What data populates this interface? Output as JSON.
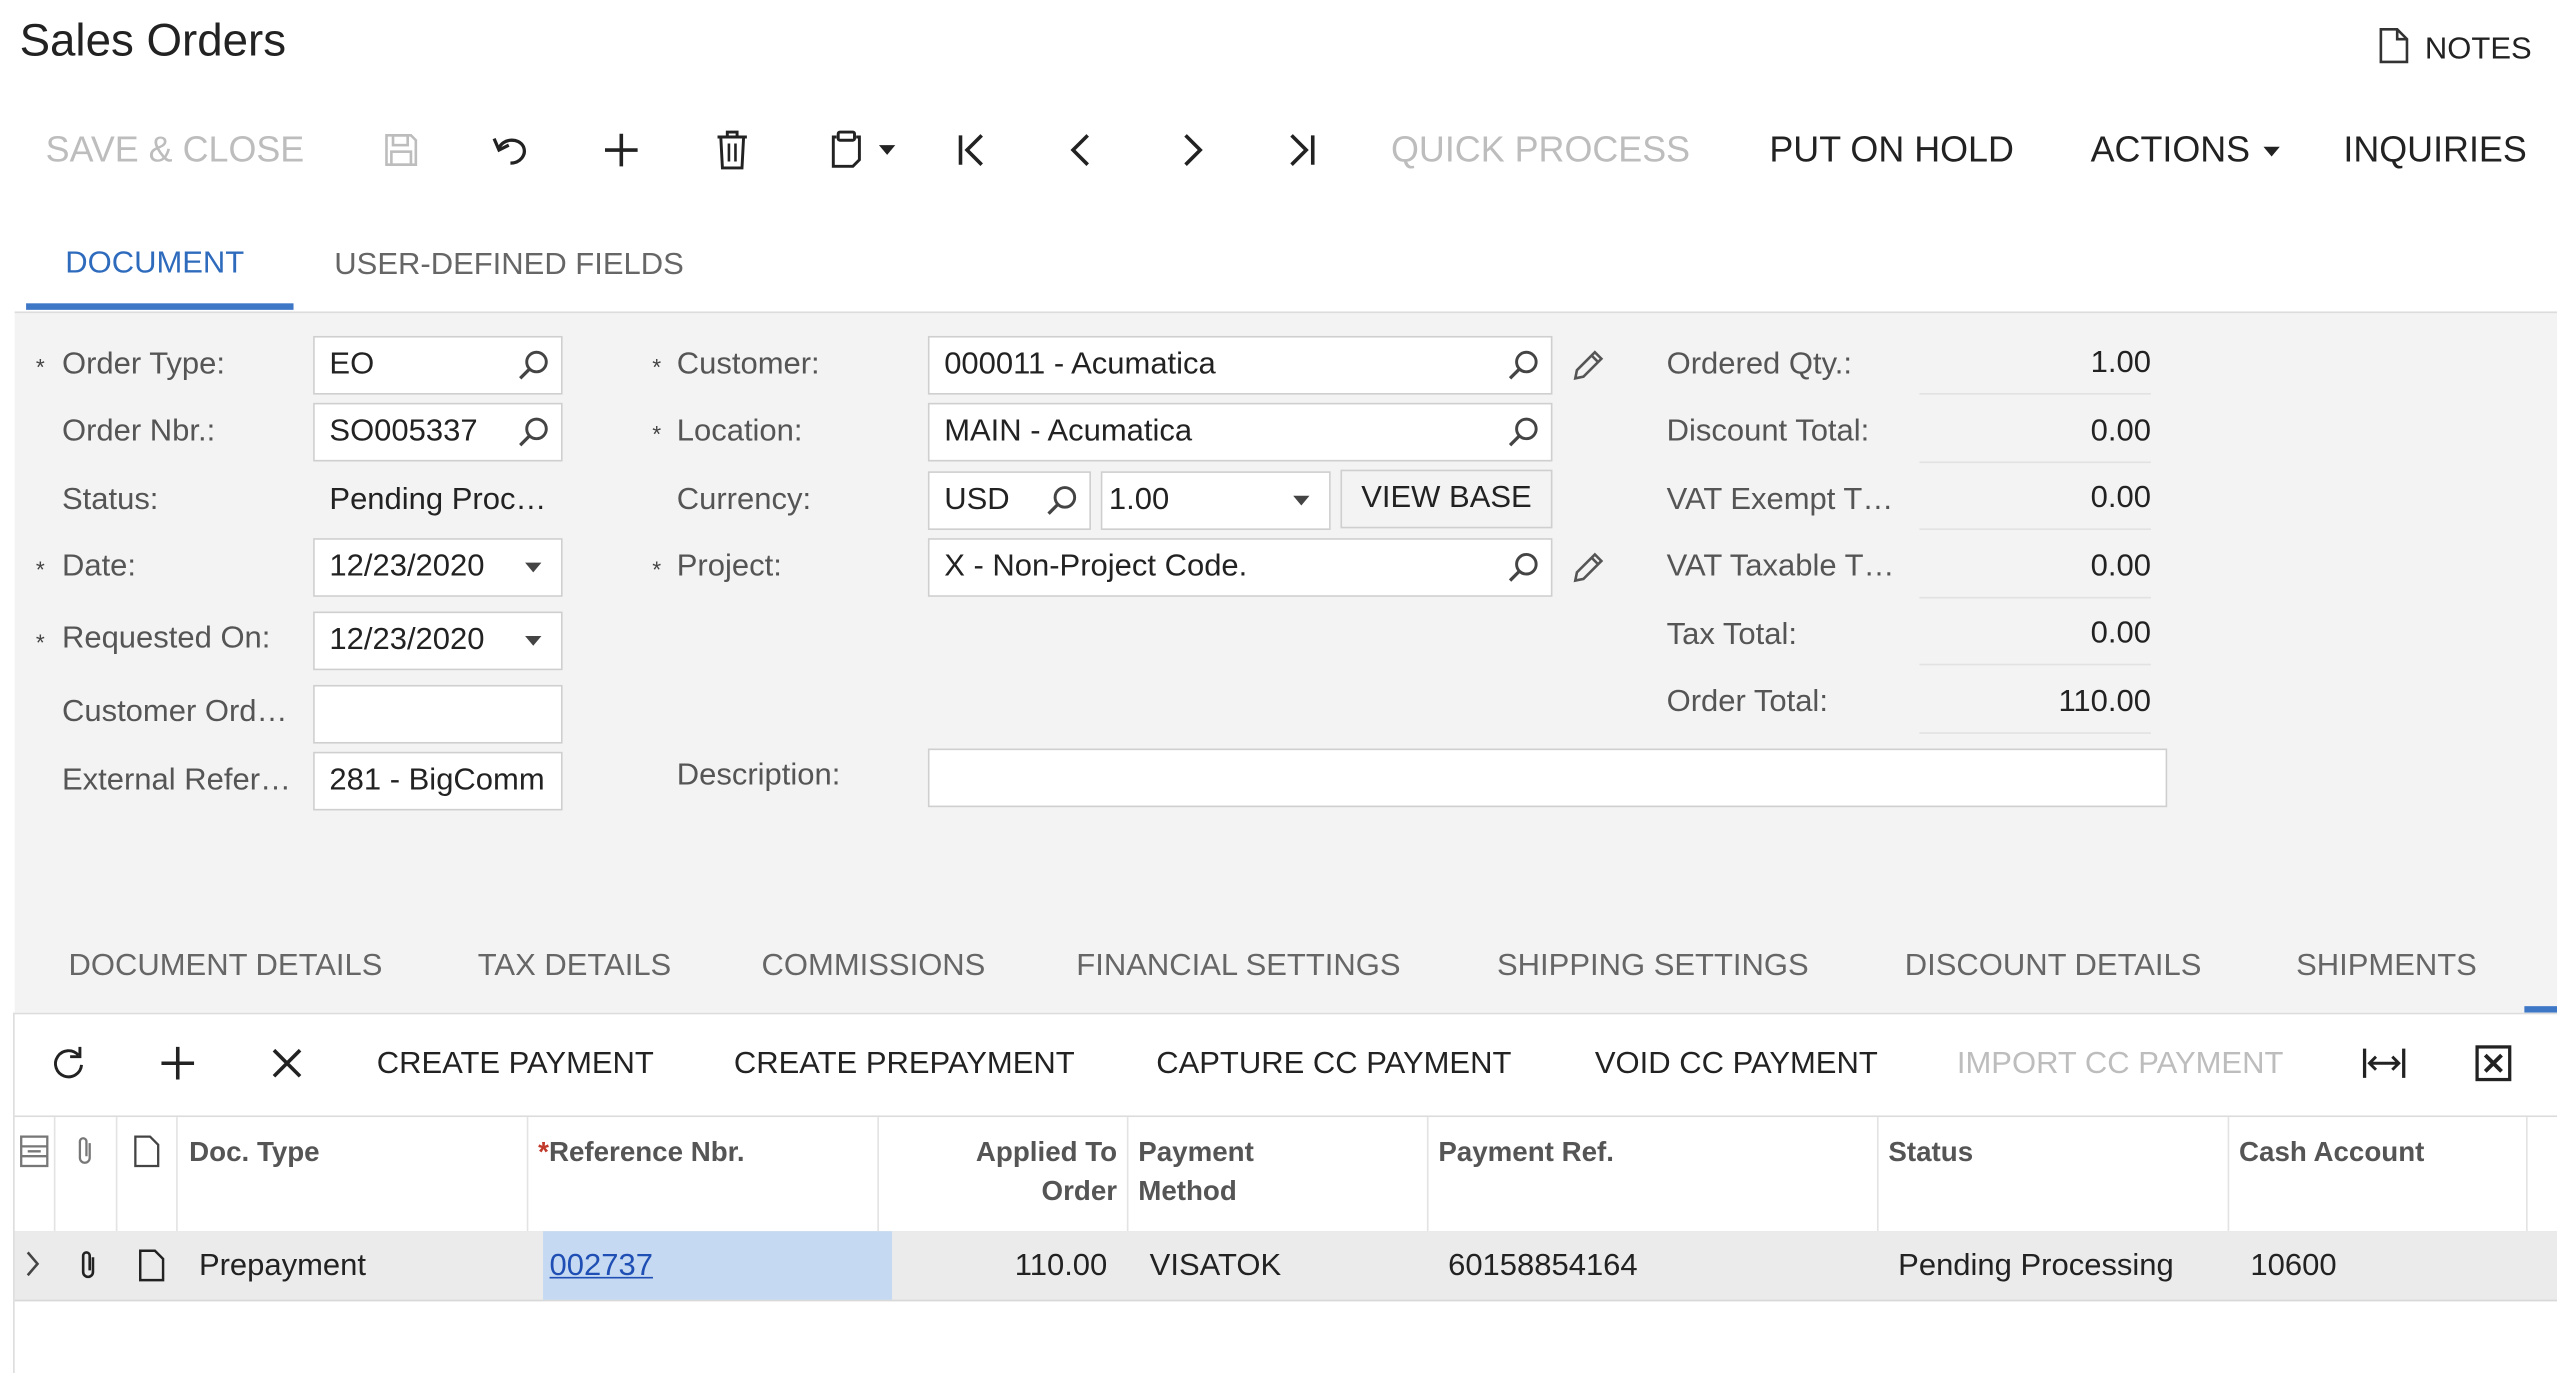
{
  "page": {
    "title": "Sales Orders",
    "notes_label": "NOTES"
  },
  "toolbar": {
    "save_close": "SAVE & CLOSE",
    "quick_process": "QUICK PROCESS",
    "put_on_hold": "PUT ON HOLD",
    "actions": "ACTIONS",
    "inquiries": "INQUIRIES",
    "icons": [
      "save-icon",
      "undo-icon",
      "add-icon",
      "delete-icon",
      "clipboard-icon",
      "first-icon",
      "previous-icon",
      "next-icon",
      "last-icon"
    ]
  },
  "top_tabs": [
    {
      "label": "DOCUMENT",
      "active": true
    },
    {
      "label": "USER-DEFINED FIELDS",
      "active": false
    }
  ],
  "form": {
    "required_mark": "*",
    "order_type": {
      "label": "Order Type:",
      "value": "EO"
    },
    "order_nbr": {
      "label": "Order Nbr.:",
      "value": "SO005337"
    },
    "status": {
      "label": "Status:",
      "value": "Pending Proc…"
    },
    "date": {
      "label": "Date:",
      "value": "12/23/2020"
    },
    "requested_on": {
      "label": "Requested On:",
      "value": "12/23/2020"
    },
    "customer_ord": {
      "label": "Customer Ord…",
      "value": ""
    },
    "external_ref": {
      "label": "External Refer…",
      "value": "281 - BigComm"
    },
    "customer": {
      "label": "Customer:",
      "value": "000011 - Acumatica"
    },
    "location": {
      "label": "Location:",
      "value": "MAIN - Acumatica"
    },
    "currency": {
      "label": "Currency:",
      "value": "USD",
      "rate": "1.00",
      "view_base": "VIEW BASE"
    },
    "project": {
      "label": "Project:",
      "value": "X - Non-Project Code."
    },
    "description": {
      "label": "Description:",
      "value": ""
    }
  },
  "totals": [
    {
      "label": "Ordered Qty.:",
      "value": "1.00"
    },
    {
      "label": "Discount Total:",
      "value": "0.00"
    },
    {
      "label": "VAT Exempt T…",
      "value": "0.00"
    },
    {
      "label": "VAT Taxable T…",
      "value": "0.00"
    },
    {
      "label": "Tax Total:",
      "value": "0.00"
    },
    {
      "label": "Order Total:",
      "value": "110.00"
    }
  ],
  "bottom_tabs": [
    "DOCUMENT DETAILS",
    "TAX DETAILS",
    "COMMISSIONS",
    "FINANCIAL SETTINGS",
    "SHIPPING SETTINGS",
    "DISCOUNT DETAILS",
    "SHIPMENTS"
  ],
  "grid_toolbar": {
    "create_payment": "CREATE PAYMENT",
    "create_prepayment": "CREATE PREPAYMENT",
    "capture_cc_payment": "CAPTURE CC PAYMENT",
    "void_cc_payment": "VOID CC PAYMENT",
    "import_cc_payment": "IMPORT CC PAYMENT"
  },
  "grid": {
    "columns": {
      "doc_type": "Doc. Type",
      "reference_nbr": "Reference Nbr.",
      "applied_line1": "Applied To",
      "applied_line2": "Order",
      "payment_line1": "Payment",
      "payment_line2": "Method",
      "payment_ref": "Payment Ref.",
      "status": "Status",
      "cash_account": "Cash Account"
    },
    "rows": [
      {
        "doc_type": "Prepayment",
        "reference_nbr": "002737",
        "applied_to_order": "110.00",
        "payment_method": "VISATOK",
        "payment_ref": "60158854164",
        "status": "Pending Processing",
        "cash_account": "10600"
      }
    ]
  },
  "colors": {
    "accent": "#3d77c6",
    "link": "#1f4fb4",
    "selected_cell": "#c5daf2",
    "disabled": "#bdbdbd"
  }
}
